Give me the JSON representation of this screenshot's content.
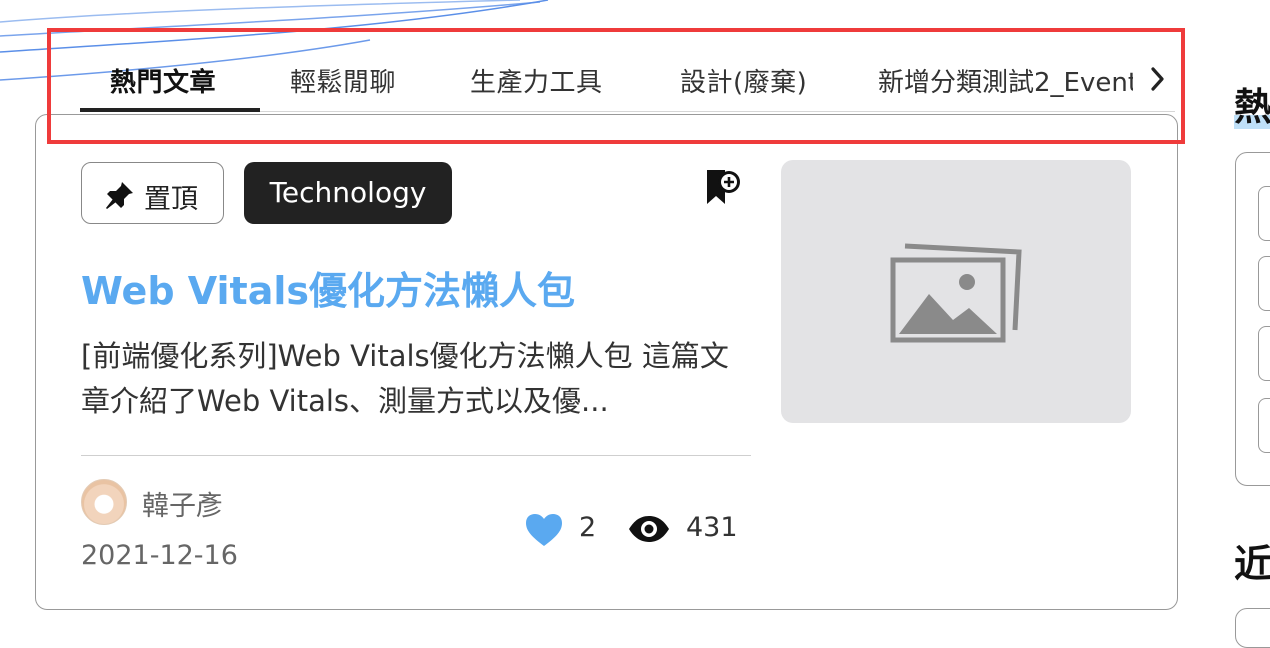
{
  "tabs": [
    {
      "label": "熱門文章",
      "active": true
    },
    {
      "label": "輕鬆閒聊",
      "active": false
    },
    {
      "label": "生產力工具",
      "active": false
    },
    {
      "label": "設計(廢棄)",
      "active": false
    },
    {
      "label": "新增分類測試2_Event",
      "active": false
    }
  ],
  "card": {
    "pin_label": "置頂",
    "tag": "Technology",
    "title": "Web Vitals優化方法懶人包",
    "excerpt": "[前端優化系列]Web Vitals優化方法懶人包 這篇文章介紹了Web Vitals、測量方式以及優...",
    "author": "韓子彥",
    "date": "2021-12-16",
    "likes": "2",
    "views": "431",
    "like_color": "#5aa9f0"
  },
  "sidebar": {
    "heading_1": "熱",
    "heading_2": "近"
  },
  "colors": {
    "accent": "#5aa9f0",
    "highlight_border": "#ef3b3b",
    "tag_bg": "#222222"
  },
  "icons": [
    "pin-icon",
    "bookmark-add-icon",
    "image-placeholder-icon",
    "heart-icon",
    "eye-icon",
    "chevron-right-icon"
  ]
}
